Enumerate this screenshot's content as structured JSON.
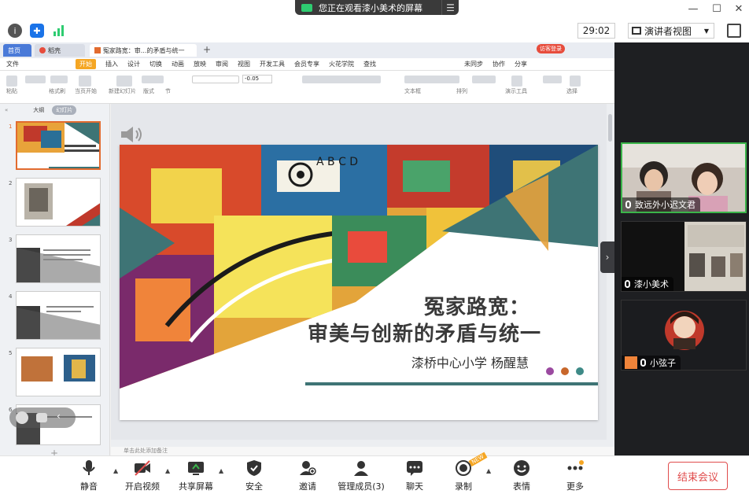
{
  "banner": {
    "text": "您正在观看漆小美术的屏幕",
    "menu_icon": "menu-icon"
  },
  "window": {
    "minimize": "—",
    "maximize": "☐",
    "close": "✕"
  },
  "toolbar_top": {
    "timer": "29:02",
    "view_mode": "演讲者视图",
    "icons": [
      "info-icon",
      "shield-icon",
      "signal-icon",
      "fullscreen-icon"
    ]
  },
  "wps": {
    "tabs": [
      {
        "label": "首页"
      },
      {
        "label": "稻壳"
      },
      {
        "label": "冤家路宽：审...的矛盾与统一"
      }
    ],
    "login_label": "访客登录",
    "menu": [
      "文件",
      "开始",
      "插入",
      "设计",
      "切换",
      "动画",
      "放映",
      "审阅",
      "视图",
      "开发工具",
      "会员专享",
      "火花学院",
      "查找"
    ],
    "menu_right": [
      "未同步",
      "协作",
      "分享"
    ],
    "ribbon_labels": [
      "粘贴",
      "格式刷",
      "当页开始",
      "新建幻灯片",
      "版式",
      "节",
      "文本框",
      "排列",
      "演示工具",
      "选择"
    ],
    "font_size": "-0.05",
    "panel_tabs": [
      "大纲",
      "幻灯片"
    ],
    "slide_numbers": [
      "1",
      "2",
      "3",
      "4",
      "5",
      "6"
    ],
    "notes_placeholder": "单击此处添加备注"
  },
  "slide": {
    "title_line1": "冤家路宽：",
    "title_line2": "审美与创新的矛盾与统一",
    "author": "漆桥中心小学  杨醒慧",
    "dot_colors": [
      "#9b4aa0",
      "#c8672b",
      "#3e8a87"
    ],
    "accent_teal": "#3e7475"
  },
  "participants": [
    {
      "name": "致远外小迟文君",
      "active": true
    },
    {
      "name": "漆小美术",
      "active": false
    },
    {
      "name": "小弦子",
      "active": false
    }
  ],
  "bottom_bar": [
    {
      "label": "静音",
      "icon": "microphone-icon"
    },
    {
      "label": "开启视频",
      "icon": "video-off-icon"
    },
    {
      "label": "共享屏幕",
      "icon": "share-screen-icon"
    },
    {
      "label": "安全",
      "icon": "security-icon"
    },
    {
      "label": "邀请",
      "icon": "invite-icon"
    },
    {
      "label": "管理成员(3)",
      "icon": "members-icon"
    },
    {
      "label": "聊天",
      "icon": "chat-icon"
    },
    {
      "label": "录制",
      "icon": "record-icon"
    },
    {
      "label": "表情",
      "icon": "emoji-icon"
    },
    {
      "label": "更多",
      "icon": "more-icon"
    }
  ],
  "record_badge": "NEW",
  "end_meeting": "结束会议",
  "colors": {
    "brand_blue": "#1a73e8",
    "end_red": "#e04c4c",
    "active_green": "#3bb54a",
    "wps_orange": "#f5a623"
  }
}
